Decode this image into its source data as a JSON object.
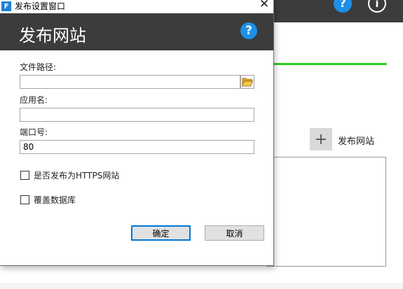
{
  "background_app": {
    "add_site_label": "发布网站",
    "add_icon": "plus-icon",
    "help_icon": "question-icon",
    "info_icon": "info-icon"
  },
  "dialog": {
    "window_title": "发布设置窗口",
    "header_title": "发布网站",
    "file_path": {
      "label": "文件路径:",
      "value": "",
      "placeholder": ""
    },
    "app_name": {
      "label": "应用名:",
      "value": "",
      "placeholder": ""
    },
    "port": {
      "label": "端口号:",
      "value": "80",
      "placeholder": ""
    },
    "https_checkbox": {
      "label": "是否发布为HTTPS网站",
      "checked": false
    },
    "overwrite_db_checkbox": {
      "label": "覆盖数据库",
      "checked": false
    },
    "ok_label": "确定",
    "cancel_label": "取消"
  },
  "colors": {
    "header_bg": "#3c3c3c",
    "help_blue": "#1e90e8",
    "accent_green": "#2ecc22",
    "focus_blue": "#0078d7"
  }
}
